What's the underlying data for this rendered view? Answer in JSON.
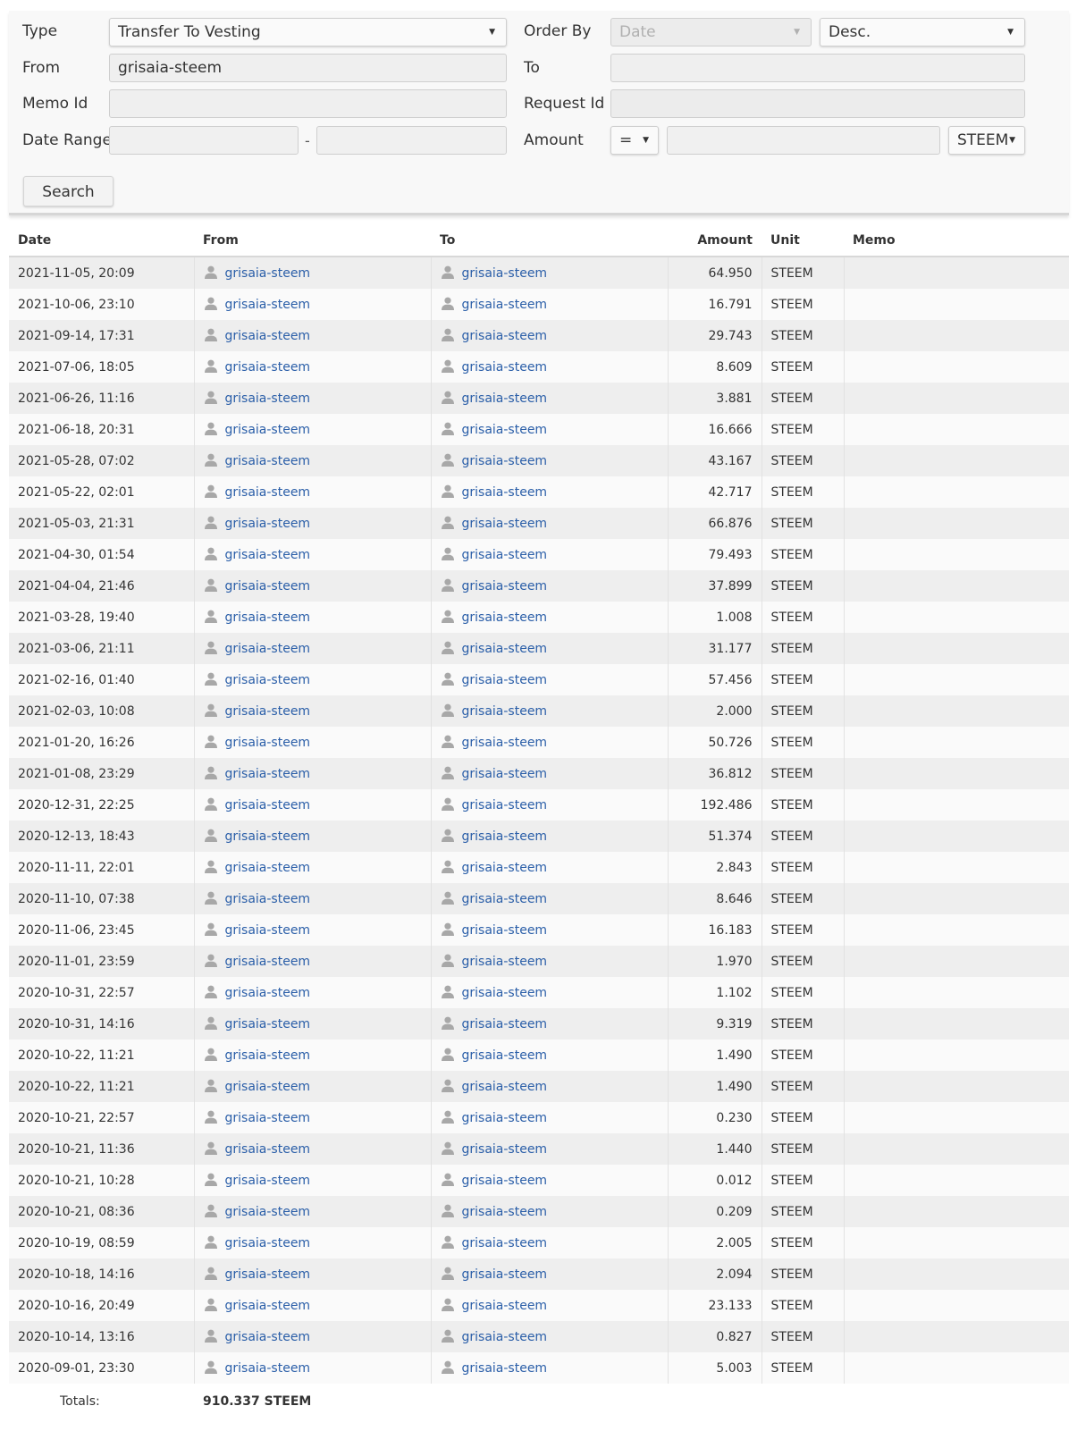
{
  "filters": {
    "type_label": "Type",
    "type_value": "Transfer To Vesting",
    "from_label": "From",
    "from_value": "grisaia-steem",
    "memo_label": "Memo Id",
    "memo_value": "",
    "date_label": "Date Range",
    "date_from": "",
    "date_to": "",
    "date_sep": "-",
    "order_label": "Order By",
    "order_by": "Date",
    "order_dir": "Desc.",
    "to_label": "To",
    "to_value": "",
    "request_label": "Request Id",
    "request_value": "",
    "amount_label": "Amount",
    "amount_op": "=",
    "amount_value": "",
    "amount_unit": "STEEM",
    "search_label": "Search"
  },
  "table": {
    "columns": [
      "Date",
      "From",
      "To",
      "Amount",
      "Unit",
      "Memo"
    ],
    "rows": [
      {
        "date": "2021-11-05, 20:09",
        "from": "grisaia-steem",
        "to": "grisaia-steem",
        "amount": "64.950",
        "unit": "STEEM",
        "memo": ""
      },
      {
        "date": "2021-10-06, 23:10",
        "from": "grisaia-steem",
        "to": "grisaia-steem",
        "amount": "16.791",
        "unit": "STEEM",
        "memo": ""
      },
      {
        "date": "2021-09-14, 17:31",
        "from": "grisaia-steem",
        "to": "grisaia-steem",
        "amount": "29.743",
        "unit": "STEEM",
        "memo": ""
      },
      {
        "date": "2021-07-06, 18:05",
        "from": "grisaia-steem",
        "to": "grisaia-steem",
        "amount": "8.609",
        "unit": "STEEM",
        "memo": ""
      },
      {
        "date": "2021-06-26, 11:16",
        "from": "grisaia-steem",
        "to": "grisaia-steem",
        "amount": "3.881",
        "unit": "STEEM",
        "memo": ""
      },
      {
        "date": "2021-06-18, 20:31",
        "from": "grisaia-steem",
        "to": "grisaia-steem",
        "amount": "16.666",
        "unit": "STEEM",
        "memo": ""
      },
      {
        "date": "2021-05-28, 07:02",
        "from": "grisaia-steem",
        "to": "grisaia-steem",
        "amount": "43.167",
        "unit": "STEEM",
        "memo": ""
      },
      {
        "date": "2021-05-22, 02:01",
        "from": "grisaia-steem",
        "to": "grisaia-steem",
        "amount": "42.717",
        "unit": "STEEM",
        "memo": ""
      },
      {
        "date": "2021-05-03, 21:31",
        "from": "grisaia-steem",
        "to": "grisaia-steem",
        "amount": "66.876",
        "unit": "STEEM",
        "memo": ""
      },
      {
        "date": "2021-04-30, 01:54",
        "from": "grisaia-steem",
        "to": "grisaia-steem",
        "amount": "79.493",
        "unit": "STEEM",
        "memo": ""
      },
      {
        "date": "2021-04-04, 21:46",
        "from": "grisaia-steem",
        "to": "grisaia-steem",
        "amount": "37.899",
        "unit": "STEEM",
        "memo": ""
      },
      {
        "date": "2021-03-28, 19:40",
        "from": "grisaia-steem",
        "to": "grisaia-steem",
        "amount": "1.008",
        "unit": "STEEM",
        "memo": ""
      },
      {
        "date": "2021-03-06, 21:11",
        "from": "grisaia-steem",
        "to": "grisaia-steem",
        "amount": "31.177",
        "unit": "STEEM",
        "memo": ""
      },
      {
        "date": "2021-02-16, 01:40",
        "from": "grisaia-steem",
        "to": "grisaia-steem",
        "amount": "57.456",
        "unit": "STEEM",
        "memo": ""
      },
      {
        "date": "2021-02-03, 10:08",
        "from": "grisaia-steem",
        "to": "grisaia-steem",
        "amount": "2.000",
        "unit": "STEEM",
        "memo": ""
      },
      {
        "date": "2021-01-20, 16:26",
        "from": "grisaia-steem",
        "to": "grisaia-steem",
        "amount": "50.726",
        "unit": "STEEM",
        "memo": ""
      },
      {
        "date": "2021-01-08, 23:29",
        "from": "grisaia-steem",
        "to": "grisaia-steem",
        "amount": "36.812",
        "unit": "STEEM",
        "memo": ""
      },
      {
        "date": "2020-12-31, 22:25",
        "from": "grisaia-steem",
        "to": "grisaia-steem",
        "amount": "192.486",
        "unit": "STEEM",
        "memo": ""
      },
      {
        "date": "2020-12-13, 18:43",
        "from": "grisaia-steem",
        "to": "grisaia-steem",
        "amount": "51.374",
        "unit": "STEEM",
        "memo": ""
      },
      {
        "date": "2020-11-11, 22:01",
        "from": "grisaia-steem",
        "to": "grisaia-steem",
        "amount": "2.843",
        "unit": "STEEM",
        "memo": ""
      },
      {
        "date": "2020-11-10, 07:38",
        "from": "grisaia-steem",
        "to": "grisaia-steem",
        "amount": "8.646",
        "unit": "STEEM",
        "memo": ""
      },
      {
        "date": "2020-11-06, 23:45",
        "from": "grisaia-steem",
        "to": "grisaia-steem",
        "amount": "16.183",
        "unit": "STEEM",
        "memo": ""
      },
      {
        "date": "2020-11-01, 23:59",
        "from": "grisaia-steem",
        "to": "grisaia-steem",
        "amount": "1.970",
        "unit": "STEEM",
        "memo": ""
      },
      {
        "date": "2020-10-31, 22:57",
        "from": "grisaia-steem",
        "to": "grisaia-steem",
        "amount": "1.102",
        "unit": "STEEM",
        "memo": ""
      },
      {
        "date": "2020-10-31, 14:16",
        "from": "grisaia-steem",
        "to": "grisaia-steem",
        "amount": "9.319",
        "unit": "STEEM",
        "memo": ""
      },
      {
        "date": "2020-10-22, 11:21",
        "from": "grisaia-steem",
        "to": "grisaia-steem",
        "amount": "1.490",
        "unit": "STEEM",
        "memo": ""
      },
      {
        "date": "2020-10-22, 11:21",
        "from": "grisaia-steem",
        "to": "grisaia-steem",
        "amount": "1.490",
        "unit": "STEEM",
        "memo": ""
      },
      {
        "date": "2020-10-21, 22:57",
        "from": "grisaia-steem",
        "to": "grisaia-steem",
        "amount": "0.230",
        "unit": "STEEM",
        "memo": ""
      },
      {
        "date": "2020-10-21, 11:36",
        "from": "grisaia-steem",
        "to": "grisaia-steem",
        "amount": "1.440",
        "unit": "STEEM",
        "memo": ""
      },
      {
        "date": "2020-10-21, 10:28",
        "from": "grisaia-steem",
        "to": "grisaia-steem",
        "amount": "0.012",
        "unit": "STEEM",
        "memo": ""
      },
      {
        "date": "2020-10-21, 08:36",
        "from": "grisaia-steem",
        "to": "grisaia-steem",
        "amount": "0.209",
        "unit": "STEEM",
        "memo": ""
      },
      {
        "date": "2020-10-19, 08:59",
        "from": "grisaia-steem",
        "to": "grisaia-steem",
        "amount": "2.005",
        "unit": "STEEM",
        "memo": ""
      },
      {
        "date": "2020-10-18, 14:16",
        "from": "grisaia-steem",
        "to": "grisaia-steem",
        "amount": "2.094",
        "unit": "STEEM",
        "memo": ""
      },
      {
        "date": "2020-10-16, 20:49",
        "from": "grisaia-steem",
        "to": "grisaia-steem",
        "amount": "23.133",
        "unit": "STEEM",
        "memo": ""
      },
      {
        "date": "2020-10-14, 13:16",
        "from": "grisaia-steem",
        "to": "grisaia-steem",
        "amount": "0.827",
        "unit": "STEEM",
        "memo": ""
      },
      {
        "date": "2020-09-01, 23:30",
        "from": "grisaia-steem",
        "to": "grisaia-steem",
        "amount": "5.003",
        "unit": "STEEM",
        "memo": ""
      }
    ],
    "totals_label": "Totals:",
    "totals_value": "910.337 STEEM"
  },
  "icons": {
    "user_icon": "user-silhouette-icon",
    "dropdown_icon": "caret-down-icon"
  },
  "colors": {
    "link": "#2a5ea8",
    "row_odd": "#eeeeee",
    "row_even": "#fafafa",
    "user_icon": "#a8a8a8"
  }
}
